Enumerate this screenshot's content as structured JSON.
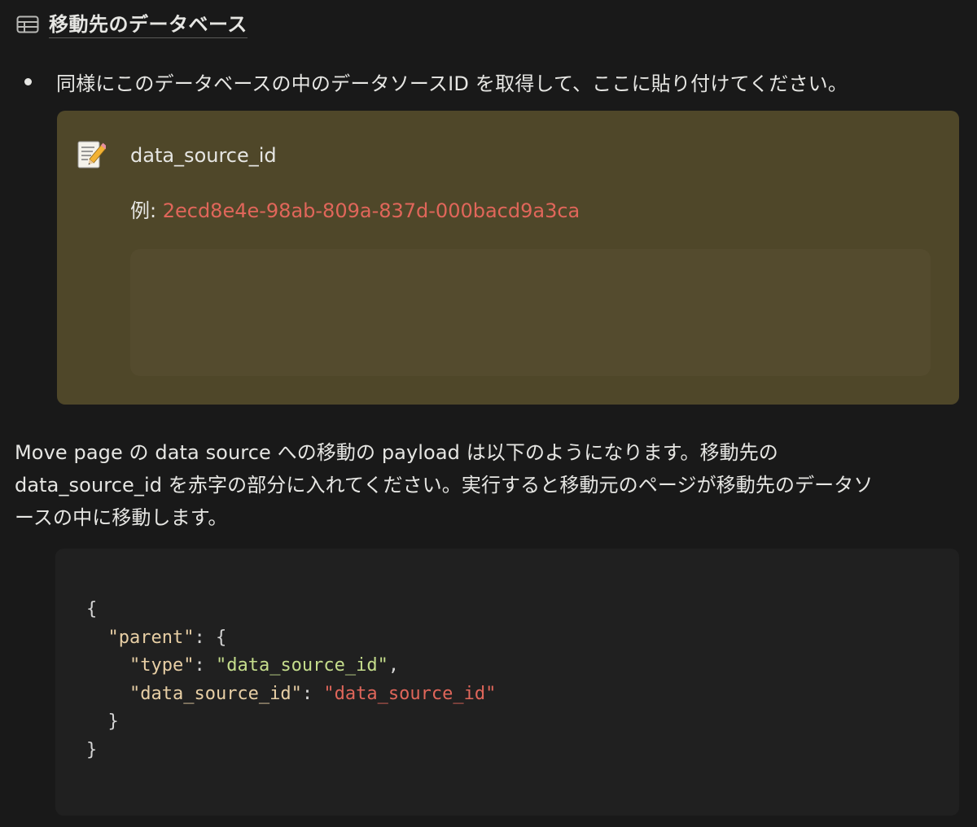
{
  "database_link": {
    "icon": "table-icon",
    "title": "移動先のデータベース"
  },
  "bullet": {
    "text": "同様にこのデータベースの中のデータソースID を取得して、ここに貼り付けてください。"
  },
  "callout": {
    "icon": "memo-icon",
    "title": "data_source_id",
    "example_label": "例: ",
    "example_value": "2ecd8e4e-98ab-809a-837d-000bacd9a3ca",
    "input_value": "",
    "accent_color": "#e0665a",
    "background_color": "#4f4729"
  },
  "paragraph": {
    "lines": [
      "Move page の data source への移動の payload は以下のようになります。移動先の",
      "data_source_id を赤字の部分に入れてください。実行すると移動元のページが移動先のデータソ",
      "ースの中に移動します。"
    ]
  },
  "code": {
    "line1_open": "{",
    "line2_indent": "  ",
    "line2_key": "\"parent\"",
    "line2_rest": ": {",
    "line3_indent": "    ",
    "line3_key": "\"type\"",
    "line3_colon": ": ",
    "line3_value": "\"data_source_id\"",
    "line3_comma": ",",
    "line4_indent": "    ",
    "line4_key": "\"data_source_id\"",
    "line4_colon": ": ",
    "line4_value": "\"data_source_id\"",
    "line5": "  }",
    "line6": "}"
  }
}
